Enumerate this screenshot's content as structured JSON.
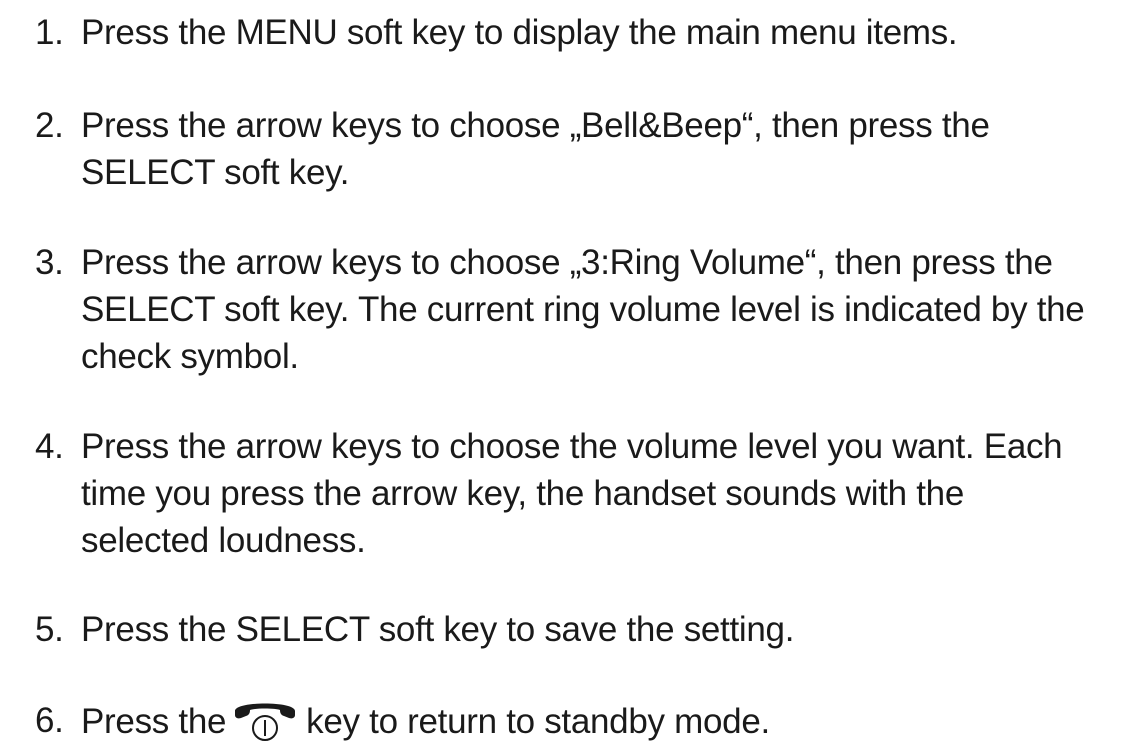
{
  "steps": [
    {
      "number": "1.",
      "lines": [
        "Press the MENU soft key to display the main menu items."
      ]
    },
    {
      "number": "2.",
      "lines": [
        "Press the arrow keys to choose „Bell&Beep“, then press the",
        "SELECT soft key."
      ]
    },
    {
      "number": "3.",
      "lines": [
        "Press the arrow keys to choose „3:Ring Volume“, then press the",
        "SELECT soft key. The current ring volume level is indicated by the",
        "check symbol."
      ]
    },
    {
      "number": "4.",
      "lines": [
        "Press the arrow keys to choose the volume level you want. Each",
        "time you press the arrow key, the handset sounds with the",
        "selected loudness."
      ]
    },
    {
      "number": "5.",
      "lines": [
        "Press the SELECT soft key to save the setting."
      ]
    },
    {
      "number": "6.",
      "before_icon": "Press the",
      "after_icon": "key to return to standby mode.",
      "icon": "end-call-power-key-icon"
    }
  ]
}
